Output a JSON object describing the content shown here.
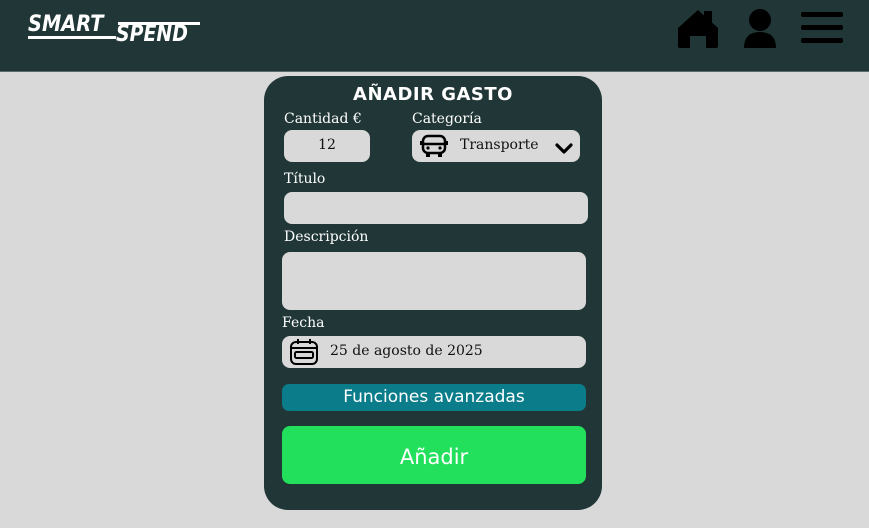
{
  "app": {
    "logo_top": "SMART",
    "logo_bottom": "SPEND"
  },
  "nav": {
    "icons": [
      "home-icon",
      "user-icon",
      "menu-icon"
    ]
  },
  "form": {
    "title": "AÑADIR GASTO",
    "amount_label": "Cantidad €",
    "amount_value": "12",
    "category_label": "Categoría",
    "category_value": "Transporte",
    "category_icon": "bus-icon",
    "title_label": "Título",
    "title_value": "",
    "description_label": "Descripción",
    "description_value": "",
    "date_label": "Fecha",
    "date_value": "25 de agosto de 2025",
    "advanced_button": "Funciones avanzadas",
    "add_button": "Añadir"
  },
  "colors": {
    "header_bg": "#213636",
    "page_bg": "#d9d9d9",
    "field_bg": "#d9d9d9",
    "advanced_bg": "#0b7c8a",
    "add_bg": "#22e05c"
  }
}
